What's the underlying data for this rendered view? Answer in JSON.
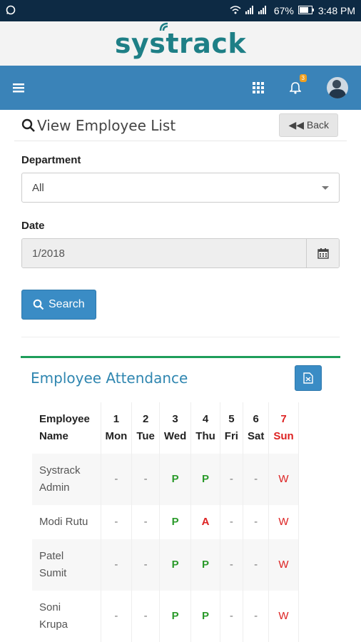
{
  "status": {
    "time": "3:48 PM",
    "battery": "67%"
  },
  "brand": {
    "logo": "systrack"
  },
  "nav": {
    "notifications": "3"
  },
  "panel": {
    "title": "View Employee List",
    "back_label": "Back"
  },
  "form": {
    "department_label": "Department",
    "department_value": "All",
    "date_label": "Date",
    "date_value": "1/2018",
    "search_label": "Search"
  },
  "attendance": {
    "title": "Employee Attendance",
    "header": {
      "name": [
        "Employee",
        "Name"
      ],
      "days": [
        {
          "num": "1",
          "day": "Mon"
        },
        {
          "num": "2",
          "day": "Tue"
        },
        {
          "num": "3",
          "day": "Wed"
        },
        {
          "num": "4",
          "day": "Thu"
        },
        {
          "num": "5",
          "day": "Fri"
        },
        {
          "num": "6",
          "day": "Sat"
        },
        {
          "num": "7",
          "day": "Sun"
        }
      ]
    },
    "rows": [
      {
        "name": [
          "Systrack",
          "Admin"
        ],
        "cells": [
          "-",
          "-",
          "P",
          "P",
          "-",
          "-",
          "W"
        ]
      },
      {
        "name": [
          "Modi Rutu"
        ],
        "cells": [
          "-",
          "-",
          "P",
          "A",
          "-",
          "-",
          "W"
        ]
      },
      {
        "name": [
          "Patel",
          "Sumit"
        ],
        "cells": [
          "-",
          "-",
          "P",
          "P",
          "-",
          "-",
          "W"
        ]
      },
      {
        "name": [
          "Soni",
          "Krupa"
        ],
        "cells": [
          "-",
          "-",
          "P",
          "P",
          "-",
          "-",
          "W"
        ]
      }
    ]
  }
}
